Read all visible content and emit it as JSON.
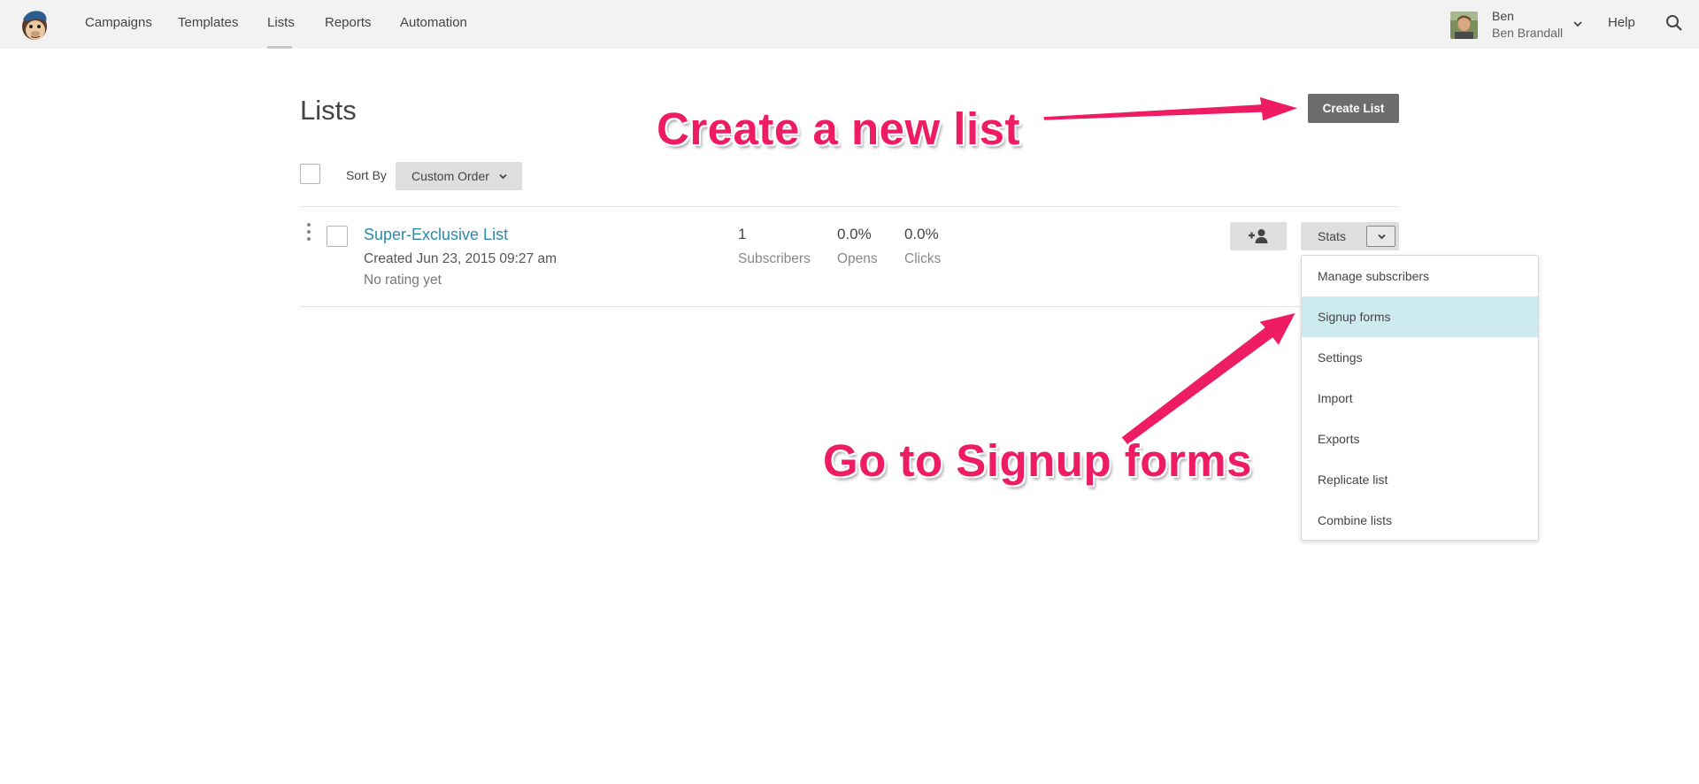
{
  "nav": {
    "items": [
      {
        "label": "Campaigns"
      },
      {
        "label": "Templates"
      },
      {
        "label": "Lists"
      },
      {
        "label": "Reports"
      },
      {
        "label": "Automation"
      }
    ],
    "active": "Lists",
    "user_first": "Ben",
    "user_full": "Ben Brandall",
    "help": "Help"
  },
  "page": {
    "title": "Lists",
    "create_button": "Create List",
    "sort_label": "Sort By",
    "sort_value": "Custom Order"
  },
  "list": {
    "name": "Super-Exclusive List",
    "created": "Created Jun 23, 2015 09:27 am",
    "rating": "No rating yet",
    "stats": [
      {
        "value": "1",
        "label": "Subscribers"
      },
      {
        "value": "0.0%",
        "label": "Opens"
      },
      {
        "value": "0.0%",
        "label": "Clicks"
      }
    ],
    "stats_button": "Stats"
  },
  "menu": {
    "items": [
      {
        "label": "Manage subscribers"
      },
      {
        "label": "Signup forms"
      },
      {
        "label": "Settings"
      },
      {
        "label": "Import"
      },
      {
        "label": "Exports"
      },
      {
        "label": "Replicate list"
      },
      {
        "label": "Combine lists"
      }
    ],
    "highlighted": "Signup forms"
  },
  "annotations": {
    "create": "Create a new list",
    "signup": "Go to Signup forms"
  },
  "colors": {
    "annotation": "#ee1c63",
    "link": "#2a8aa8",
    "menu_highlight": "#cdeaf1",
    "primary_button": "#6d6d6d"
  }
}
